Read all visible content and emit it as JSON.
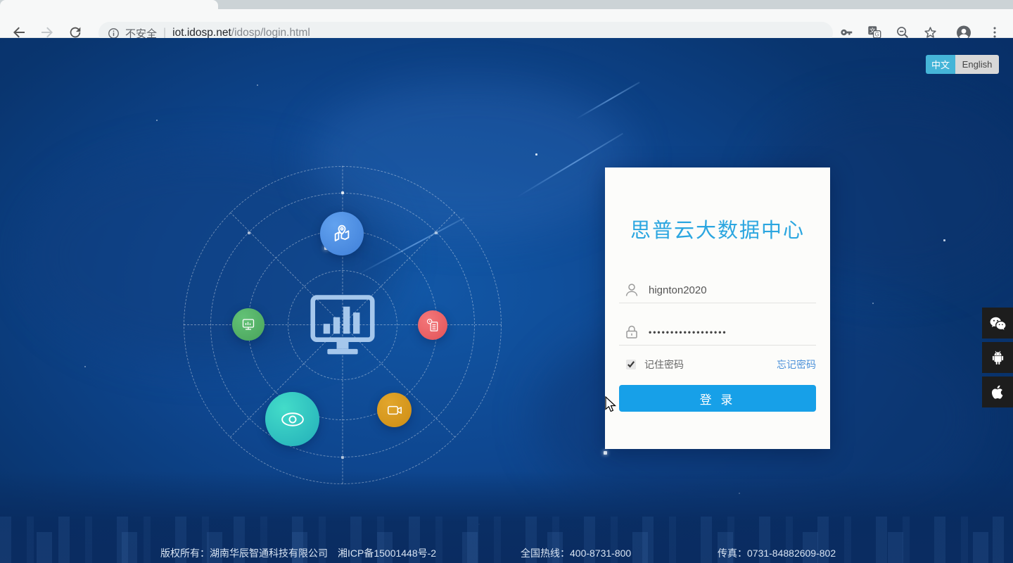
{
  "browser": {
    "security_label": "不安全",
    "url_host": "iot.idosp.net",
    "url_path": "/idosp/login.html",
    "separator": "|"
  },
  "language_toggle": {
    "chinese_label": "中文",
    "english_label": "English",
    "active": "中文"
  },
  "login": {
    "title": "思普云大数据中心",
    "username_value": "hignton2020",
    "password_mask": "••••••••••••••••••",
    "remember_label": "记住密码",
    "remember_checked": "checked",
    "forgot_label": "忘记密码",
    "submit_label": "登 录"
  },
  "footer": {
    "copyright": "版权所有：湖南华辰智通科技有限公司",
    "icp": "湘ICP备15001448号-2",
    "hotline": "全国热线：400-8731-800",
    "fax": "传真：0731-84882609-802"
  },
  "app_dock": {
    "items": [
      "wechat-icon",
      "android-icon",
      "apple-icon"
    ]
  },
  "orbit_icons": [
    "map-pin-icon",
    "monitor-report-icon",
    "document-clock-icon",
    "eye-monitoring-icon",
    "video-camera-icon",
    "dashboard-monitor-icon"
  ],
  "colors": {
    "title_blue": "#2ba6e0",
    "button_blue": "#17a0e8",
    "link_blue": "#4a90d9",
    "toggle_active": "#45b5d8",
    "background_blue": "#0e468f",
    "satellite_blue": "#3f7fd8",
    "satellite_green": "#49a35b",
    "satellite_red": "#e25257",
    "satellite_teal": "#23aeb9",
    "satellite_orange": "#cd8d14"
  }
}
